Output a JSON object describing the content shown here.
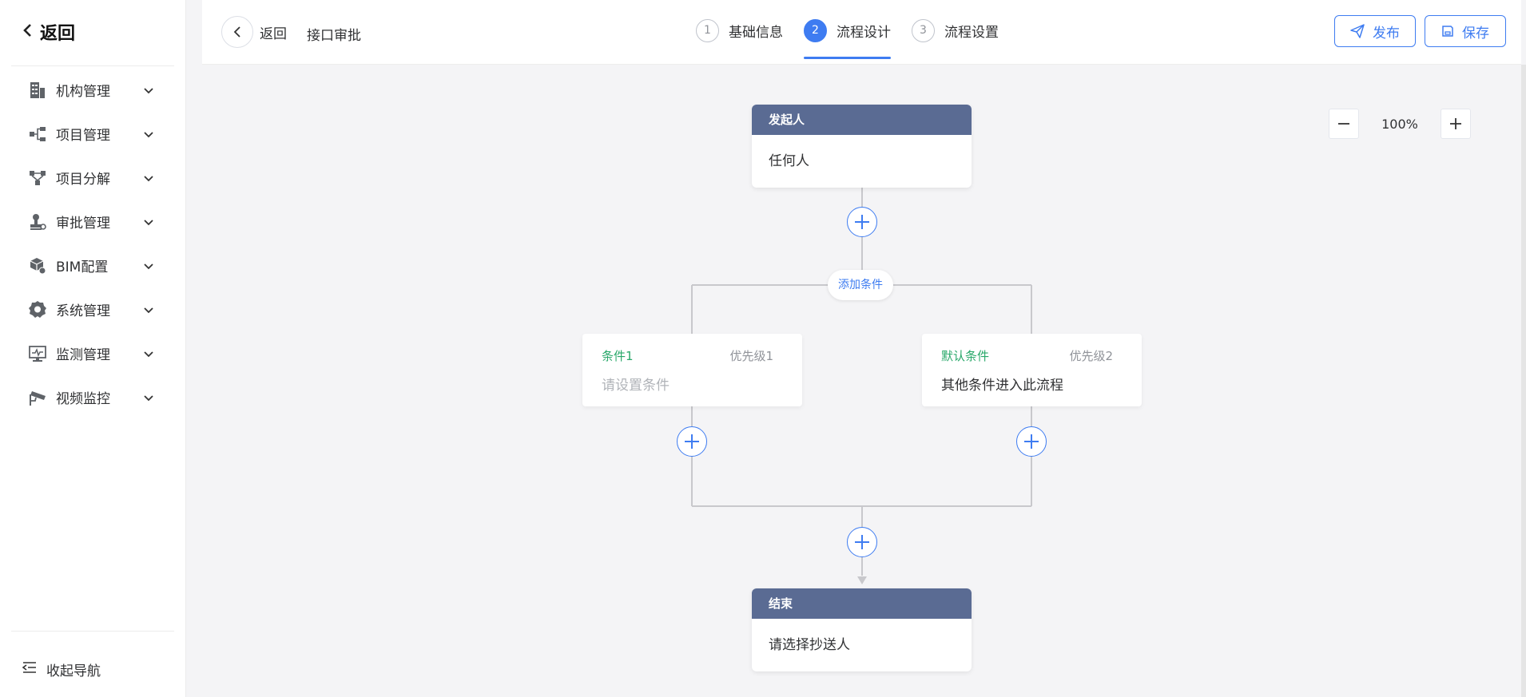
{
  "sidebar": {
    "back_label": "返回",
    "items": [
      {
        "label": "机构管理",
        "icon": "building-icon"
      },
      {
        "label": "项目管理",
        "icon": "project-tree-icon"
      },
      {
        "label": "项目分解",
        "icon": "breakdown-icon"
      },
      {
        "label": "审批管理",
        "icon": "approval-stamp-icon"
      },
      {
        "label": "BIM配置",
        "icon": "bim-cube-icon"
      },
      {
        "label": "系统管理",
        "icon": "gear-icon"
      },
      {
        "label": "监测管理",
        "icon": "monitor-icon"
      },
      {
        "label": "视频监控",
        "icon": "camera-icon"
      }
    ],
    "collapse_label": "收起导航"
  },
  "header": {
    "back_label": "返回",
    "title": "接口审批",
    "steps": [
      {
        "num": "1",
        "label": "基础信息",
        "active": false
      },
      {
        "num": "2",
        "label": "流程设计",
        "active": true
      },
      {
        "num": "3",
        "label": "流程设置",
        "active": false
      }
    ],
    "publish_label": "发布",
    "save_label": "保存"
  },
  "canvas": {
    "zoom": "100%",
    "start_node": {
      "title": "发起人",
      "body": "任何人"
    },
    "add_condition_label": "添加条件",
    "conditions": [
      {
        "title": "条件1",
        "priority": "优先级1",
        "body": "请设置条件",
        "placeholder": true
      },
      {
        "title": "默认条件",
        "priority": "优先级2",
        "body": "其他条件进入此流程",
        "placeholder": false
      }
    ],
    "end_node": {
      "title": "结束",
      "body": "请选择抄送人"
    }
  },
  "colors": {
    "accent": "#3e7cf1",
    "node_header": "#5a6b93",
    "condition_title": "#29a86a"
  }
}
